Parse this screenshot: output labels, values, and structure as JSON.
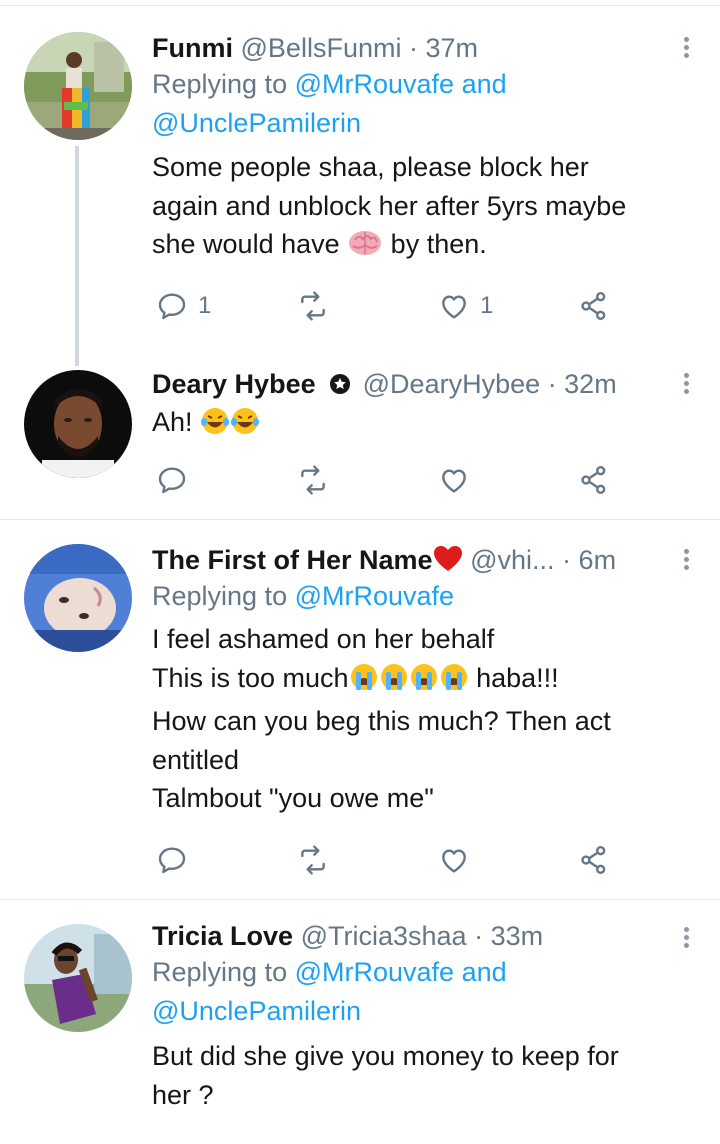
{
  "tweets": [
    {
      "name": "Funmi",
      "handle": "@BellsFunmi",
      "time": "37m",
      "replying_prefix": "Replying to",
      "replying_handle1": "@MrRouvafe",
      "replying_and": "and",
      "replying_handle2": "@UnclePamilerin",
      "line1": "Some people shaa, please block her",
      "line2": "again and unblock her after 5yrs maybe",
      "line3a": "she would have",
      "line3b": "by then.",
      "reply_count": "1",
      "like_count": "1"
    },
    {
      "name": "Deary Hybee",
      "handle": "@DearyHybee",
      "time": "32m",
      "line1": "Ah!"
    },
    {
      "name": "The First of Her Name",
      "handle": "@vhi...",
      "time": "6m",
      "replying_prefix": "Replying to",
      "replying_handle1": "@MrRouvafe",
      "line1": "I feel ashamed on her behalf",
      "line2a": "This is too much",
      "line2b": "haba!!!",
      "line3": "How can you beg this much? Then act",
      "line4": "entitled",
      "line5": "Talmbout \"you  owe me\""
    },
    {
      "name": "Tricia Love",
      "handle": "@Tricia3shaa",
      "time": "33m",
      "replying_prefix": "Replying to",
      "replying_handle1": "@MrRouvafe",
      "replying_and": "and",
      "replying_handle2": "@UnclePamilerin",
      "line1": "But did she give you money to keep for",
      "line2": "her ?"
    }
  ],
  "colors": {
    "link": "#1da1f2",
    "meta": "#657786",
    "divider": "#e1e8ed",
    "thread_line": "#cfd9de"
  },
  "icons": [
    "reply-icon",
    "retweet-icon",
    "like-icon",
    "share-icon",
    "more-icon",
    "verified-icon",
    "brain-emoji",
    "laughing-emoji",
    "crying-emoji",
    "heart-emoji"
  ]
}
